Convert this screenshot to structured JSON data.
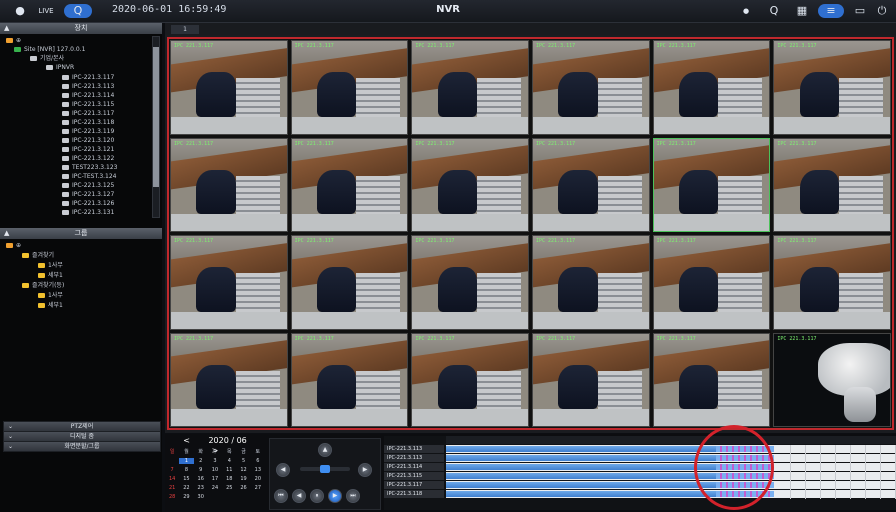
{
  "topbar": {
    "user_icon": "user-icon",
    "live_label": "LIVE",
    "search_label": "Q",
    "datetime": "2020-06-01 16:59:49",
    "title": "NVR",
    "right_buttons": [
      "●",
      "Q",
      "▦",
      "≡",
      "▭",
      "⏻"
    ]
  },
  "sidebar": {
    "device_section": "장치",
    "device_tree": [
      "Site [NVR] 127.0.0.1",
      "기업/본사",
      "IPNVR",
      "IPC-221.3.117",
      "IPC-221.3.113",
      "IPC-221.3.114",
      "IPC-221.3.115",
      "IPC-221.3.117",
      "IPC-221.3.118",
      "IPC-221.3.119",
      "IPC-221.3.120",
      "IPC-221.3.121",
      "IPC-221.3.122",
      "TEST223.3.123",
      "IPC-TEST.3.124",
      "IPC-221.3.125",
      "IPC-221.3.127",
      "IPC-221.3.126",
      "IPC-221.3.131"
    ],
    "group_section": "그룹",
    "group_tree": [
      "즐겨찾기",
      "1사무",
      "세부1",
      "즐겨찾기(등)",
      "1사무",
      "세부1"
    ],
    "accordions": [
      "PTZ제어",
      "디지털 줌",
      "화면분할/그룹"
    ]
  },
  "video": {
    "tab_label": "1",
    "camera_label": "IPC 221.3.117",
    "tiles": 24,
    "selected_tile": 10
  },
  "calendar": {
    "prev": "<",
    "next": ">",
    "month": "2020 / 06",
    "dow": [
      "일",
      "월",
      "화",
      "수",
      "목",
      "금",
      "토"
    ],
    "days": [
      "",
      "1",
      "2",
      "3",
      "4",
      "5",
      "6",
      "7",
      "8",
      "9",
      "10",
      "11",
      "12",
      "13",
      "14",
      "15",
      "16",
      "17",
      "18",
      "19",
      "20",
      "21",
      "22",
      "23",
      "24",
      "25",
      "26",
      "27",
      "28",
      "29",
      "30"
    ],
    "today": "1"
  },
  "timeline": {
    "channels": [
      "IPC-221.3.113",
      "IPC-221.3.113",
      "IPC-221.3.114",
      "IPC-221.3.115",
      "IPC-221.3.117",
      "IPC-221.3.118"
    ]
  },
  "colors": {
    "highlight": "#d3222b",
    "accent": "#2f6fd0",
    "selection": "#4cc25b",
    "record": "#3f7fcf"
  }
}
